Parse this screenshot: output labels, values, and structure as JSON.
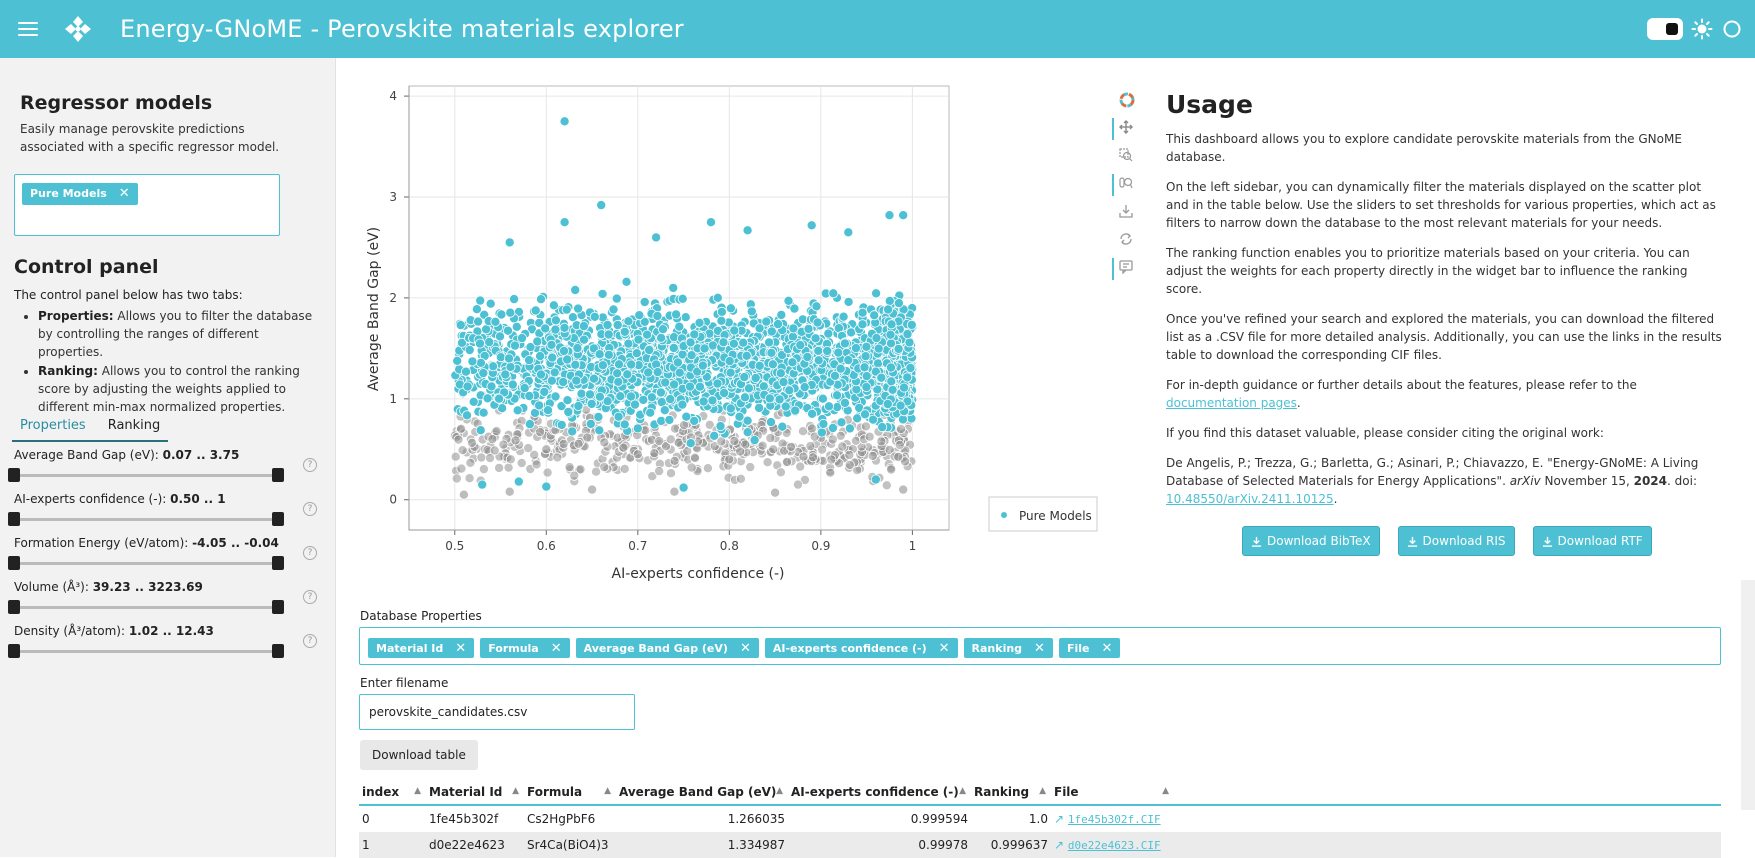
{
  "header": {
    "title": "Energy-GNoME  -  Perovskite materials explorer",
    "accent": "#4dc1d3"
  },
  "sidebar": {
    "regressor": {
      "title": "Regressor models",
      "description": "Easily manage perovskite predictions associated with a specific regressor model.",
      "selected": [
        "Pure Models"
      ]
    },
    "control_panel": {
      "title": "Control panel",
      "intro": "The control panel below has two tabs:",
      "items": [
        {
          "name": "Properties",
          "text": "Allows you to filter the database by controlling the ranges of different properties."
        },
        {
          "name": "Ranking",
          "text": "Allows you to control the ranking score by adjusting the weights applied to different min-max normalized properties."
        }
      ]
    },
    "tabs": [
      "Properties",
      "Ranking"
    ],
    "active_tab": "Properties",
    "sliders": [
      {
        "label": "Average Band Gap (eV):",
        "value": "0.07 .. 3.75"
      },
      {
        "label": "AI-experts confidence (-):",
        "value": "0.50 .. 1"
      },
      {
        "label": "Formation Energy (eV/atom):",
        "value": "-4.05 .. -0.04"
      },
      {
        "label": "Volume (Å³):",
        "value": "39.23 .. 3223.69"
      },
      {
        "label": "Density (Å³/atom):",
        "value": "1.02 .. 12.43"
      }
    ]
  },
  "chart_data": {
    "type": "scatter",
    "title": "",
    "xlabel": "AI-experts confidence (-)",
    "ylabel": "Average Band Gap (eV)",
    "xlim": [
      0.45,
      1.04
    ],
    "ylim": [
      -0.3,
      4.1
    ],
    "x_ticks": [
      "0.5",
      "0.6",
      "0.7",
      "0.8",
      "0.9",
      "1"
    ],
    "y_ticks": [
      "0",
      "1",
      "2",
      "3",
      "4"
    ],
    "grid": true,
    "legend": "right",
    "series": [
      {
        "name": "Pure Models",
        "color": "#4dc1d3",
        "points": [
          [
            0.62,
            3.75
          ],
          [
            0.66,
            2.92
          ],
          [
            0.56,
            2.55
          ],
          [
            0.78,
            2.75
          ],
          [
            0.62,
            2.75
          ],
          [
            0.89,
            2.72
          ],
          [
            0.99,
            2.82
          ],
          [
            0.975,
            2.82
          ],
          [
            0.72,
            2.6
          ],
          [
            0.82,
            2.67
          ],
          [
            0.93,
            2.65
          ],
          [
            0.53,
            0.15
          ],
          [
            0.57,
            0.18
          ],
          [
            0.6,
            0.13
          ],
          [
            0.75,
            0.12
          ],
          [
            0.96,
            0.2
          ]
        ]
      },
      {
        "name": "",
        "color": "#9a9a9a",
        "points": [
          [
            0.51,
            0.05
          ],
          [
            0.56,
            0.08
          ],
          [
            0.65,
            0.1
          ],
          [
            0.74,
            0.08
          ],
          [
            0.85,
            0.07
          ],
          [
            0.99,
            0.1
          ],
          [
            0.6,
            0.5
          ],
          [
            0.7,
            0.45
          ],
          [
            0.8,
            0.4
          ]
        ]
      }
    ]
  },
  "toolbar": [
    "bokeh-logo-icon",
    "pan-icon",
    "box-zoom-icon",
    "wheel-zoom-icon",
    "save-icon",
    "reset-icon",
    "hover-icon"
  ],
  "usage": {
    "title": "Usage",
    "p1": "This dashboard allows you to explore candidate perovskite materials from the GNoME database.",
    "p2": "On the left sidebar, you can dynamically filter the materials displayed on the scatter plot and in the table below. Use the sliders to set thresholds for various properties, which act as filters to narrow down the database to the most relevant materials for your needs.",
    "p3": "The ranking function enables you to prioritize materials based on your criteria. You can adjust the weights for each property directly in the widget bar to influence the ranking score.",
    "p4": "Once you've refined your search and explored the materials, you can download the filtered list as a .CSV file for more detailed analysis. Additionally, you can use the links in the results table to download the corresponding CIF files.",
    "p5_pre": "For in-depth guidance or further details about the features, please refer to the ",
    "p5_link": "documentation pages",
    "p5_post": ".",
    "p6": "If you find this dataset valuable, please consider citing the original work:",
    "citation_authors": "De Angelis, P.; Trezza, G.; Barletta, G.; Asinari, P.; Chiavazzo, E. \"Energy-GNoME: A Living Database of Selected Materials for Energy Applications\". ",
    "citation_journal": "arXiv",
    "citation_date": " November 15, ",
    "citation_year": "2024",
    "citation_doi_pre": ". doi: ",
    "citation_doi": "10.48550/arXiv.2411.10125",
    "citation_end": ".",
    "buttons": [
      "Download BibTeX",
      "Download RIS",
      "Download RTF"
    ]
  },
  "database": {
    "label": "Database Properties",
    "selected": [
      "Material Id",
      "Formula",
      "Average Band Gap (eV)",
      "AI-experts confidence (-)",
      "Ranking",
      "File"
    ],
    "filename_label": "Enter filename",
    "filename_value": "perovskite_candidates.csv",
    "download_button": "Download table"
  },
  "table": {
    "columns": [
      "index",
      "Material Id",
      "Formula",
      "Average Band Gap (eV)",
      "AI-experts confidence (-)",
      "Ranking",
      "File"
    ],
    "rows": [
      [
        "0",
        "1fe45b302f",
        "Cs2HgPbF6",
        "1.266035",
        "0.999594",
        "1.0",
        "1fe45b302f.CIF"
      ],
      [
        "1",
        "d0e22e4623",
        "Sr4Ca(BiO4)3",
        "1.334987",
        "0.99978",
        "0.999637",
        "d0e22e4623.CIF"
      ]
    ]
  }
}
